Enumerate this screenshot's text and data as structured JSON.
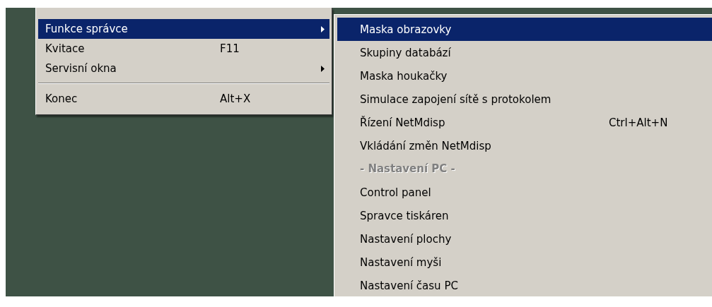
{
  "main_menu": {
    "items": [
      {
        "kind": "item",
        "label": "Funkce správce",
        "submenu": true,
        "selected": true
      },
      {
        "kind": "item",
        "label": "Kvitace",
        "shortcut": "F11",
        "submenu": false,
        "selected": false
      },
      {
        "kind": "item",
        "label": "Servisní okna",
        "submenu": true,
        "selected": false
      },
      {
        "kind": "separator"
      },
      {
        "kind": "item",
        "label": "Konec",
        "shortcut": "Alt+X",
        "submenu": false,
        "selected": false
      }
    ]
  },
  "submenu": {
    "items": [
      {
        "kind": "item",
        "label": "Maska obrazovky",
        "selected": true
      },
      {
        "kind": "item",
        "label": "Skupiny databází",
        "selected": false
      },
      {
        "kind": "item",
        "label": "Maska houkačky",
        "selected": false
      },
      {
        "kind": "item",
        "label": "Simulace zapojení sítě s protokolem",
        "selected": false
      },
      {
        "kind": "item",
        "label": "Řízení NetMdisp",
        "shortcut": "Ctrl+Alt+N",
        "selected": false
      },
      {
        "kind": "item",
        "label": "Vkládání změn NetMdisp",
        "selected": false
      },
      {
        "kind": "header",
        "label": "- Nastavení PC -"
      },
      {
        "kind": "item",
        "label": "Control panel",
        "selected": false
      },
      {
        "kind": "item",
        "label": "Spravce tiskáren",
        "selected": false
      },
      {
        "kind": "item",
        "label": "Nastavení plochy",
        "selected": false
      },
      {
        "kind": "item",
        "label": "Nastavení myši",
        "selected": false
      },
      {
        "kind": "item",
        "label": "Nastavení času PC",
        "selected": false
      }
    ]
  }
}
